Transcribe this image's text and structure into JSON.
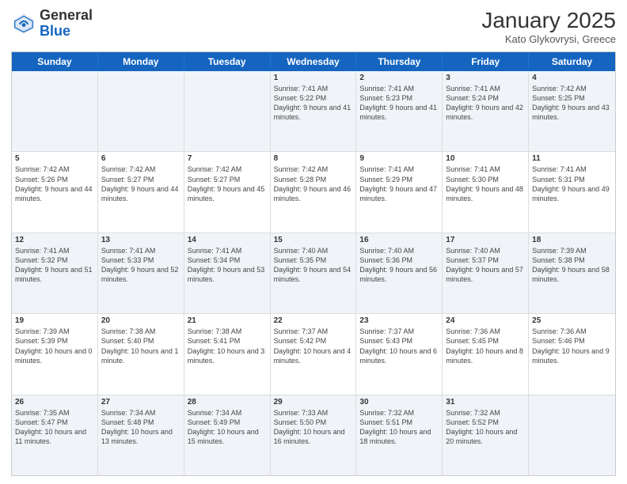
{
  "header": {
    "logo_general": "General",
    "logo_blue": "Blue",
    "month_title": "January 2025",
    "subtitle": "Kato Glykovrysi, Greece"
  },
  "days": [
    "Sunday",
    "Monday",
    "Tuesday",
    "Wednesday",
    "Thursday",
    "Friday",
    "Saturday"
  ],
  "rows": [
    [
      {
        "date": "",
        "info": ""
      },
      {
        "date": "",
        "info": ""
      },
      {
        "date": "",
        "info": ""
      },
      {
        "date": "1",
        "info": "Sunrise: 7:41 AM\nSunset: 5:22 PM\nDaylight: 9 hours and 41 minutes."
      },
      {
        "date": "2",
        "info": "Sunrise: 7:41 AM\nSunset: 5:23 PM\nDaylight: 9 hours and 41 minutes."
      },
      {
        "date": "3",
        "info": "Sunrise: 7:41 AM\nSunset: 5:24 PM\nDaylight: 9 hours and 42 minutes."
      },
      {
        "date": "4",
        "info": "Sunrise: 7:42 AM\nSunset: 5:25 PM\nDaylight: 9 hours and 43 minutes."
      }
    ],
    [
      {
        "date": "5",
        "info": "Sunrise: 7:42 AM\nSunset: 5:26 PM\nDaylight: 9 hours and 44 minutes."
      },
      {
        "date": "6",
        "info": "Sunrise: 7:42 AM\nSunset: 5:27 PM\nDaylight: 9 hours and 44 minutes."
      },
      {
        "date": "7",
        "info": "Sunrise: 7:42 AM\nSunset: 5:27 PM\nDaylight: 9 hours and 45 minutes."
      },
      {
        "date": "8",
        "info": "Sunrise: 7:42 AM\nSunset: 5:28 PM\nDaylight: 9 hours and 46 minutes."
      },
      {
        "date": "9",
        "info": "Sunrise: 7:41 AM\nSunset: 5:29 PM\nDaylight: 9 hours and 47 minutes."
      },
      {
        "date": "10",
        "info": "Sunrise: 7:41 AM\nSunset: 5:30 PM\nDaylight: 9 hours and 48 minutes."
      },
      {
        "date": "11",
        "info": "Sunrise: 7:41 AM\nSunset: 5:31 PM\nDaylight: 9 hours and 49 minutes."
      }
    ],
    [
      {
        "date": "12",
        "info": "Sunrise: 7:41 AM\nSunset: 5:32 PM\nDaylight: 9 hours and 51 minutes."
      },
      {
        "date": "13",
        "info": "Sunrise: 7:41 AM\nSunset: 5:33 PM\nDaylight: 9 hours and 52 minutes."
      },
      {
        "date": "14",
        "info": "Sunrise: 7:41 AM\nSunset: 5:34 PM\nDaylight: 9 hours and 53 minutes."
      },
      {
        "date": "15",
        "info": "Sunrise: 7:40 AM\nSunset: 5:35 PM\nDaylight: 9 hours and 54 minutes."
      },
      {
        "date": "16",
        "info": "Sunrise: 7:40 AM\nSunset: 5:36 PM\nDaylight: 9 hours and 56 minutes."
      },
      {
        "date": "17",
        "info": "Sunrise: 7:40 AM\nSunset: 5:37 PM\nDaylight: 9 hours and 57 minutes."
      },
      {
        "date": "18",
        "info": "Sunrise: 7:39 AM\nSunset: 5:38 PM\nDaylight: 9 hours and 58 minutes."
      }
    ],
    [
      {
        "date": "19",
        "info": "Sunrise: 7:39 AM\nSunset: 5:39 PM\nDaylight: 10 hours and 0 minutes."
      },
      {
        "date": "20",
        "info": "Sunrise: 7:38 AM\nSunset: 5:40 PM\nDaylight: 10 hours and 1 minute."
      },
      {
        "date": "21",
        "info": "Sunrise: 7:38 AM\nSunset: 5:41 PM\nDaylight: 10 hours and 3 minutes."
      },
      {
        "date": "22",
        "info": "Sunrise: 7:37 AM\nSunset: 5:42 PM\nDaylight: 10 hours and 4 minutes."
      },
      {
        "date": "23",
        "info": "Sunrise: 7:37 AM\nSunset: 5:43 PM\nDaylight: 10 hours and 6 minutes."
      },
      {
        "date": "24",
        "info": "Sunrise: 7:36 AM\nSunset: 5:45 PM\nDaylight: 10 hours and 8 minutes."
      },
      {
        "date": "25",
        "info": "Sunrise: 7:36 AM\nSunset: 5:46 PM\nDaylight: 10 hours and 9 minutes."
      }
    ],
    [
      {
        "date": "26",
        "info": "Sunrise: 7:35 AM\nSunset: 5:47 PM\nDaylight: 10 hours and 11 minutes."
      },
      {
        "date": "27",
        "info": "Sunrise: 7:34 AM\nSunset: 5:48 PM\nDaylight: 10 hours and 13 minutes."
      },
      {
        "date": "28",
        "info": "Sunrise: 7:34 AM\nSunset: 5:49 PM\nDaylight: 10 hours and 15 minutes."
      },
      {
        "date": "29",
        "info": "Sunrise: 7:33 AM\nSunset: 5:50 PM\nDaylight: 10 hours and 16 minutes."
      },
      {
        "date": "30",
        "info": "Sunrise: 7:32 AM\nSunset: 5:51 PM\nDaylight: 10 hours and 18 minutes."
      },
      {
        "date": "31",
        "info": "Sunrise: 7:32 AM\nSunset: 5:52 PM\nDaylight: 10 hours and 20 minutes."
      },
      {
        "date": "",
        "info": ""
      }
    ]
  ],
  "alt_rows": [
    0,
    2,
    4
  ]
}
